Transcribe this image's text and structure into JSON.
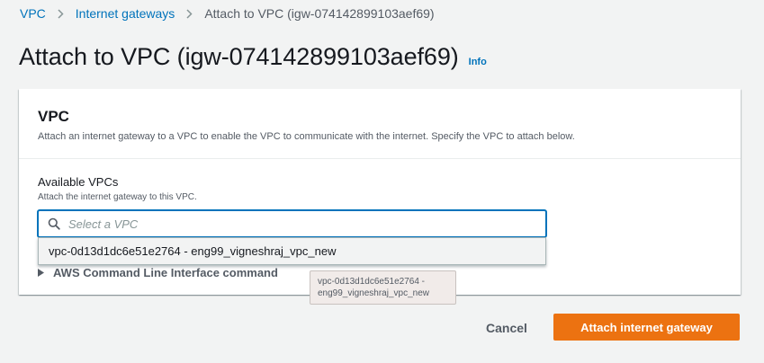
{
  "breadcrumb": {
    "items": [
      {
        "label": "VPC"
      },
      {
        "label": "Internet gateways"
      },
      {
        "label": "Attach to VPC (igw-074142899103aef69)"
      }
    ]
  },
  "page": {
    "title": "Attach to VPC (igw-074142899103aef69)",
    "info_label": "Info"
  },
  "panel": {
    "title": "VPC",
    "description": "Attach an internet gateway to a VPC to enable the VPC to communicate with the internet. Specify the VPC to attach below.",
    "field": {
      "label": "Available VPCs",
      "description": "Attach the internet gateway to this VPC.",
      "placeholder": "Select a VPC",
      "options": [
        "vpc-0d13d1dc6e51e2764 - eng99_vigneshraj_vpc_new"
      ]
    },
    "expander_label": "AWS Command Line Interface command"
  },
  "tooltip": {
    "line1": "vpc-0d13d1dc6e51e2764 -",
    "line2": "eng99_vigneshraj_vpc_new"
  },
  "actions": {
    "cancel_label": "Cancel",
    "submit_label": "Attach internet gateway"
  },
  "colors": {
    "accent": "#ec7211",
    "link": "#0073bb",
    "background": "#f2f3f3"
  },
  "icons": {
    "breadcrumb_separator": "chevron-right-icon",
    "search": "search-icon",
    "expander": "caret-right-icon"
  }
}
